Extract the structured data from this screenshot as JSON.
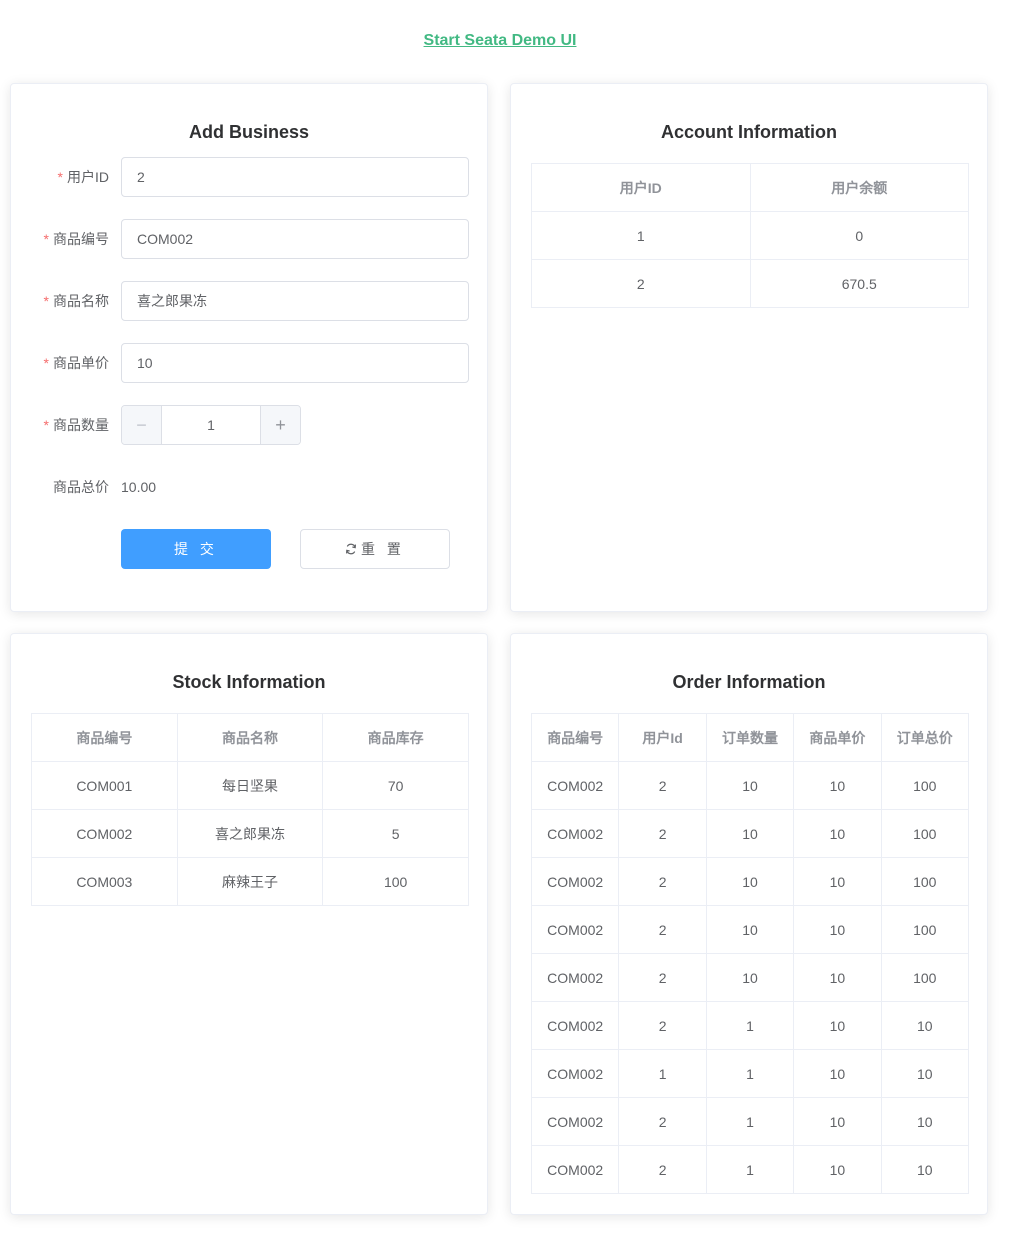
{
  "header": {
    "link_text": "Start Seata Demo UI"
  },
  "business": {
    "title": "Add Business",
    "fields": {
      "user_id": {
        "label": "用户ID",
        "value": "2"
      },
      "commodity_code": {
        "label": "商品编号",
        "value": "COM002"
      },
      "name": {
        "label": "商品名称",
        "value": "喜之郎果冻"
      },
      "price": {
        "label": "商品单价",
        "value": "10"
      },
      "count": {
        "label": "商品数量",
        "value": "1"
      },
      "total": {
        "label": "商品总价",
        "value": "10.00"
      }
    },
    "stepper": {
      "minus": "−",
      "plus": "+"
    },
    "submit_label": "提 交",
    "reset_label": "重 置"
  },
  "account": {
    "title": "Account Information",
    "columns": [
      "用户ID",
      "用户余额"
    ],
    "rows": [
      [
        "1",
        "0"
      ],
      [
        "2",
        "670.5"
      ]
    ]
  },
  "stock": {
    "title": "Stock Information",
    "columns": [
      "商品编号",
      "商品名称",
      "商品库存"
    ],
    "rows": [
      [
        "COM001",
        "每日坚果",
        "70"
      ],
      [
        "COM002",
        "喜之郎果冻",
        "5"
      ],
      [
        "COM003",
        "麻辣王子",
        "100"
      ]
    ]
  },
  "order": {
    "title": "Order Information",
    "columns": [
      "商品编号",
      "用户Id",
      "订单数量",
      "商品单价",
      "订单总价"
    ],
    "rows": [
      [
        "COM002",
        "2",
        "10",
        "10",
        "100"
      ],
      [
        "COM002",
        "2",
        "10",
        "10",
        "100"
      ],
      [
        "COM002",
        "2",
        "10",
        "10",
        "100"
      ],
      [
        "COM002",
        "2",
        "10",
        "10",
        "100"
      ],
      [
        "COM002",
        "2",
        "10",
        "10",
        "100"
      ],
      [
        "COM002",
        "2",
        "1",
        "10",
        "10"
      ],
      [
        "COM002",
        "1",
        "1",
        "10",
        "10"
      ],
      [
        "COM002",
        "2",
        "1",
        "10",
        "10"
      ],
      [
        "COM002",
        "2",
        "1",
        "10",
        "10"
      ]
    ]
  },
  "colors": {
    "link": "#42b983",
    "primary": "#409eff",
    "required": "#f56c6c"
  },
  "icons": {
    "reset": "refresh-icon"
  }
}
